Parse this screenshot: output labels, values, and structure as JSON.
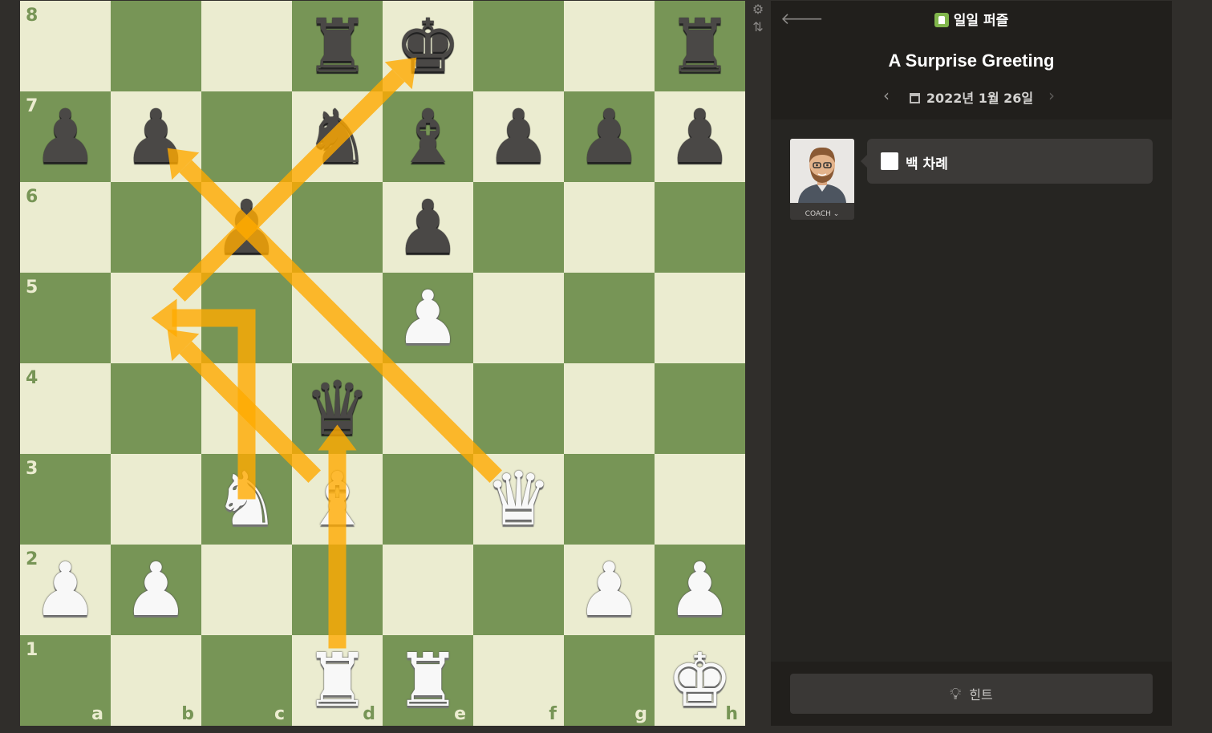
{
  "board": {
    "files": [
      "a",
      "b",
      "c",
      "d",
      "e",
      "f",
      "g",
      "h"
    ],
    "ranks": [
      "8",
      "7",
      "6",
      "5",
      "4",
      "3",
      "2",
      "1"
    ],
    "light_color": "#ebecd0",
    "dark_color": "#779556",
    "arrow_color": "#ffaa00",
    "position": [
      [
        "",
        "",
        "",
        "bR",
        "bK",
        "",
        "",
        "bR"
      ],
      [
        "bP",
        "bP",
        "",
        "bN",
        "bB",
        "bP",
        "bP",
        "bP"
      ],
      [
        "",
        "",
        "bP",
        "",
        "bP",
        "",
        "",
        ""
      ],
      [
        "",
        "",
        "",
        "",
        "wP",
        "",
        "",
        ""
      ],
      [
        "",
        "",
        "",
        "bQ",
        "",
        "",
        "",
        ""
      ],
      [
        "",
        "",
        "wN",
        "wB",
        "",
        "wQ",
        "",
        ""
      ],
      [
        "wP",
        "wP",
        "",
        "",
        "",
        "",
        "wP",
        "wP"
      ],
      [
        "",
        "",
        "",
        "wR",
        "wR",
        "",
        "",
        "wK"
      ]
    ],
    "arrows": [
      {
        "from": "f3",
        "to": "b7"
      },
      {
        "from": "d3",
        "to": "b5"
      },
      {
        "from": "c3",
        "to": "b5",
        "shape": "knight"
      },
      {
        "from": "d1",
        "to": "d4"
      },
      {
        "from": "b5",
        "to": "e8"
      }
    ]
  },
  "tools": {
    "settings_icon": "gear-icon",
    "flip_icon": "flip-board-icon"
  },
  "panel": {
    "header_title": "일일 퍼즐",
    "puzzle_title": "A Surprise Greeting",
    "date": "2022년 1월 26일",
    "coach_label": "COACH",
    "turn_text": "백 차례",
    "hint_label": "힌트"
  }
}
